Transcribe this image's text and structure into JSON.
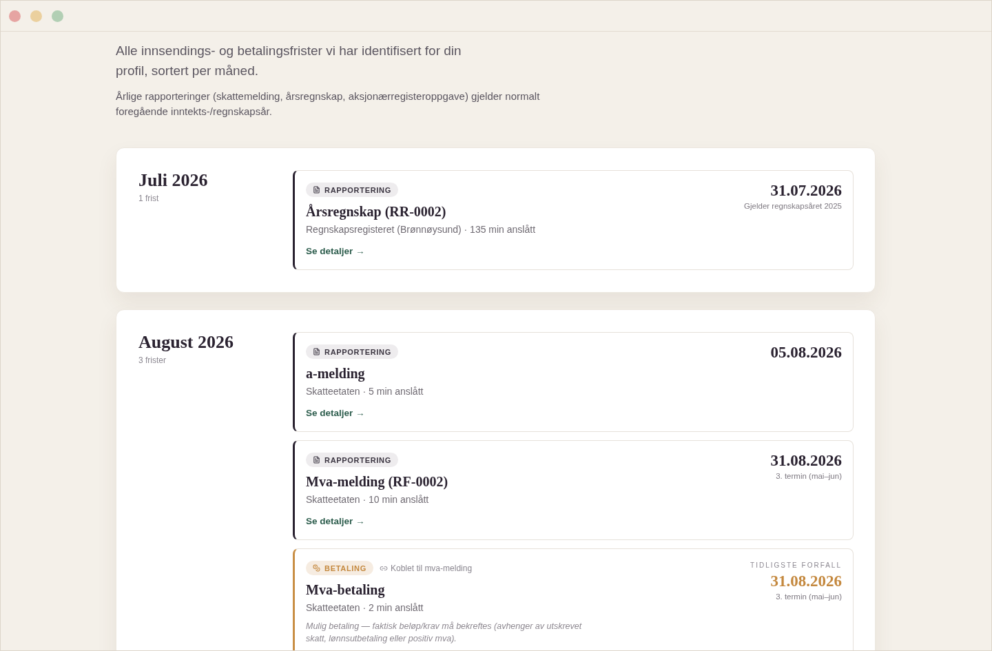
{
  "window": {
    "controls": [
      {
        "color": "#e6a4a2"
      },
      {
        "color": "#ebd09e"
      },
      {
        "color": "#b2cfb4"
      }
    ]
  },
  "intro": {
    "lead": "Alle innsendings- og betalingsfrister vi har identifisert for din profil, sortert per måned.",
    "note": "Årlige rapporteringer (skattemelding, årsregnskap, aksjonærregisteroppgave) gjelder normalt foregående inntekts-/regnskapsår."
  },
  "months": [
    {
      "title": "Juli 2026",
      "count": "1 frist",
      "deadlines": [
        {
          "kind": "rapportering",
          "badge": "RAPPORTERING",
          "title": "Årsregnskap (RR-0002)",
          "meta": "Regnskapsregisteret (Brønnøysund) · 135 min anslått",
          "link": "Se detaljer →",
          "date": "31.07.2026",
          "date_note": "Gjelder regnskapsåret 2025"
        }
      ]
    },
    {
      "title": "August 2026",
      "count": "3 frister",
      "deadlines": [
        {
          "kind": "rapportering",
          "badge": "RAPPORTERING",
          "title": "a-melding",
          "meta": "Skatteetaten · 5 min anslått",
          "link": "Se detaljer →",
          "date": "05.08.2026"
        },
        {
          "kind": "rapportering",
          "badge": "RAPPORTERING",
          "title": "Mva-melding (RF-0002)",
          "meta": "Skatteetaten · 10 min anslått",
          "link": "Se detaljer →",
          "date": "31.08.2026",
          "date_note": "3. termin (mai–jun)"
        },
        {
          "kind": "betaling",
          "badge": "BETALING",
          "linked": "Koblet til mva-melding",
          "title": "Mva-betaling",
          "meta": "Skatteetaten · 2 min anslått",
          "note": "Mulig betaling — faktisk beløp/krav må bekreftes (avhenger av utskrevet skatt, lønnsutbetaling eller positiv mva).",
          "date_label": "TIDLIGSTE FORFALL",
          "date": "31.08.2026",
          "date_note": "3. termin (mai–jun)"
        }
      ]
    }
  ]
}
